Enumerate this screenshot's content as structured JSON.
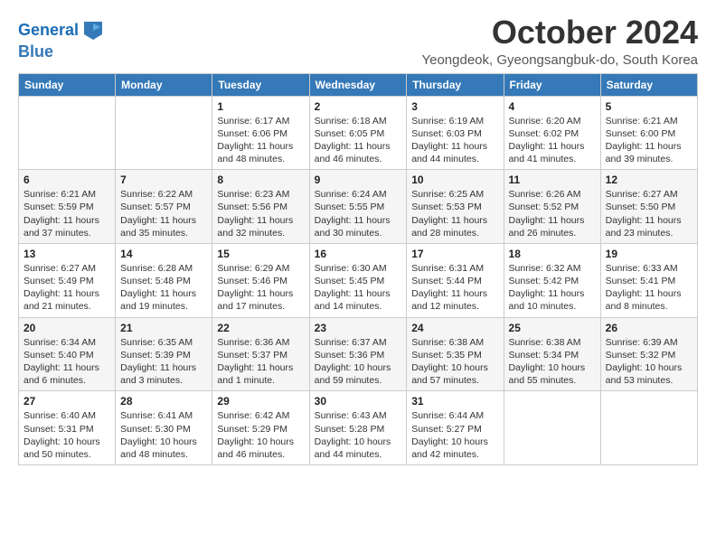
{
  "header": {
    "logo_line1": "General",
    "logo_line2": "Blue",
    "title": "October 2024",
    "location": "Yeongdeok, Gyeongsangbuk-do, South Korea"
  },
  "weekdays": [
    "Sunday",
    "Monday",
    "Tuesday",
    "Wednesday",
    "Thursday",
    "Friday",
    "Saturday"
  ],
  "weeks": [
    [
      {
        "day": "",
        "sunrise": "",
        "sunset": "",
        "daylight": ""
      },
      {
        "day": "",
        "sunrise": "",
        "sunset": "",
        "daylight": ""
      },
      {
        "day": "1",
        "sunrise": "Sunrise: 6:17 AM",
        "sunset": "Sunset: 6:06 PM",
        "daylight": "Daylight: 11 hours and 48 minutes."
      },
      {
        "day": "2",
        "sunrise": "Sunrise: 6:18 AM",
        "sunset": "Sunset: 6:05 PM",
        "daylight": "Daylight: 11 hours and 46 minutes."
      },
      {
        "day": "3",
        "sunrise": "Sunrise: 6:19 AM",
        "sunset": "Sunset: 6:03 PM",
        "daylight": "Daylight: 11 hours and 44 minutes."
      },
      {
        "day": "4",
        "sunrise": "Sunrise: 6:20 AM",
        "sunset": "Sunset: 6:02 PM",
        "daylight": "Daylight: 11 hours and 41 minutes."
      },
      {
        "day": "5",
        "sunrise": "Sunrise: 6:21 AM",
        "sunset": "Sunset: 6:00 PM",
        "daylight": "Daylight: 11 hours and 39 minutes."
      }
    ],
    [
      {
        "day": "6",
        "sunrise": "Sunrise: 6:21 AM",
        "sunset": "Sunset: 5:59 PM",
        "daylight": "Daylight: 11 hours and 37 minutes."
      },
      {
        "day": "7",
        "sunrise": "Sunrise: 6:22 AM",
        "sunset": "Sunset: 5:57 PM",
        "daylight": "Daylight: 11 hours and 35 minutes."
      },
      {
        "day": "8",
        "sunrise": "Sunrise: 6:23 AM",
        "sunset": "Sunset: 5:56 PM",
        "daylight": "Daylight: 11 hours and 32 minutes."
      },
      {
        "day": "9",
        "sunrise": "Sunrise: 6:24 AM",
        "sunset": "Sunset: 5:55 PM",
        "daylight": "Daylight: 11 hours and 30 minutes."
      },
      {
        "day": "10",
        "sunrise": "Sunrise: 6:25 AM",
        "sunset": "Sunset: 5:53 PM",
        "daylight": "Daylight: 11 hours and 28 minutes."
      },
      {
        "day": "11",
        "sunrise": "Sunrise: 6:26 AM",
        "sunset": "Sunset: 5:52 PM",
        "daylight": "Daylight: 11 hours and 26 minutes."
      },
      {
        "day": "12",
        "sunrise": "Sunrise: 6:27 AM",
        "sunset": "Sunset: 5:50 PM",
        "daylight": "Daylight: 11 hours and 23 minutes."
      }
    ],
    [
      {
        "day": "13",
        "sunrise": "Sunrise: 6:27 AM",
        "sunset": "Sunset: 5:49 PM",
        "daylight": "Daylight: 11 hours and 21 minutes."
      },
      {
        "day": "14",
        "sunrise": "Sunrise: 6:28 AM",
        "sunset": "Sunset: 5:48 PM",
        "daylight": "Daylight: 11 hours and 19 minutes."
      },
      {
        "day": "15",
        "sunrise": "Sunrise: 6:29 AM",
        "sunset": "Sunset: 5:46 PM",
        "daylight": "Daylight: 11 hours and 17 minutes."
      },
      {
        "day": "16",
        "sunrise": "Sunrise: 6:30 AM",
        "sunset": "Sunset: 5:45 PM",
        "daylight": "Daylight: 11 hours and 14 minutes."
      },
      {
        "day": "17",
        "sunrise": "Sunrise: 6:31 AM",
        "sunset": "Sunset: 5:44 PM",
        "daylight": "Daylight: 11 hours and 12 minutes."
      },
      {
        "day": "18",
        "sunrise": "Sunrise: 6:32 AM",
        "sunset": "Sunset: 5:42 PM",
        "daylight": "Daylight: 11 hours and 10 minutes."
      },
      {
        "day": "19",
        "sunrise": "Sunrise: 6:33 AM",
        "sunset": "Sunset: 5:41 PM",
        "daylight": "Daylight: 11 hours and 8 minutes."
      }
    ],
    [
      {
        "day": "20",
        "sunrise": "Sunrise: 6:34 AM",
        "sunset": "Sunset: 5:40 PM",
        "daylight": "Daylight: 11 hours and 6 minutes."
      },
      {
        "day": "21",
        "sunrise": "Sunrise: 6:35 AM",
        "sunset": "Sunset: 5:39 PM",
        "daylight": "Daylight: 11 hours and 3 minutes."
      },
      {
        "day": "22",
        "sunrise": "Sunrise: 6:36 AM",
        "sunset": "Sunset: 5:37 PM",
        "daylight": "Daylight: 11 hours and 1 minute."
      },
      {
        "day": "23",
        "sunrise": "Sunrise: 6:37 AM",
        "sunset": "Sunset: 5:36 PM",
        "daylight": "Daylight: 10 hours and 59 minutes."
      },
      {
        "day": "24",
        "sunrise": "Sunrise: 6:38 AM",
        "sunset": "Sunset: 5:35 PM",
        "daylight": "Daylight: 10 hours and 57 minutes."
      },
      {
        "day": "25",
        "sunrise": "Sunrise: 6:38 AM",
        "sunset": "Sunset: 5:34 PM",
        "daylight": "Daylight: 10 hours and 55 minutes."
      },
      {
        "day": "26",
        "sunrise": "Sunrise: 6:39 AM",
        "sunset": "Sunset: 5:32 PM",
        "daylight": "Daylight: 10 hours and 53 minutes."
      }
    ],
    [
      {
        "day": "27",
        "sunrise": "Sunrise: 6:40 AM",
        "sunset": "Sunset: 5:31 PM",
        "daylight": "Daylight: 10 hours and 50 minutes."
      },
      {
        "day": "28",
        "sunrise": "Sunrise: 6:41 AM",
        "sunset": "Sunset: 5:30 PM",
        "daylight": "Daylight: 10 hours and 48 minutes."
      },
      {
        "day": "29",
        "sunrise": "Sunrise: 6:42 AM",
        "sunset": "Sunset: 5:29 PM",
        "daylight": "Daylight: 10 hours and 46 minutes."
      },
      {
        "day": "30",
        "sunrise": "Sunrise: 6:43 AM",
        "sunset": "Sunset: 5:28 PM",
        "daylight": "Daylight: 10 hours and 44 minutes."
      },
      {
        "day": "31",
        "sunrise": "Sunrise: 6:44 AM",
        "sunset": "Sunset: 5:27 PM",
        "daylight": "Daylight: 10 hours and 42 minutes."
      },
      {
        "day": "",
        "sunrise": "",
        "sunset": "",
        "daylight": ""
      },
      {
        "day": "",
        "sunrise": "",
        "sunset": "",
        "daylight": ""
      }
    ]
  ]
}
